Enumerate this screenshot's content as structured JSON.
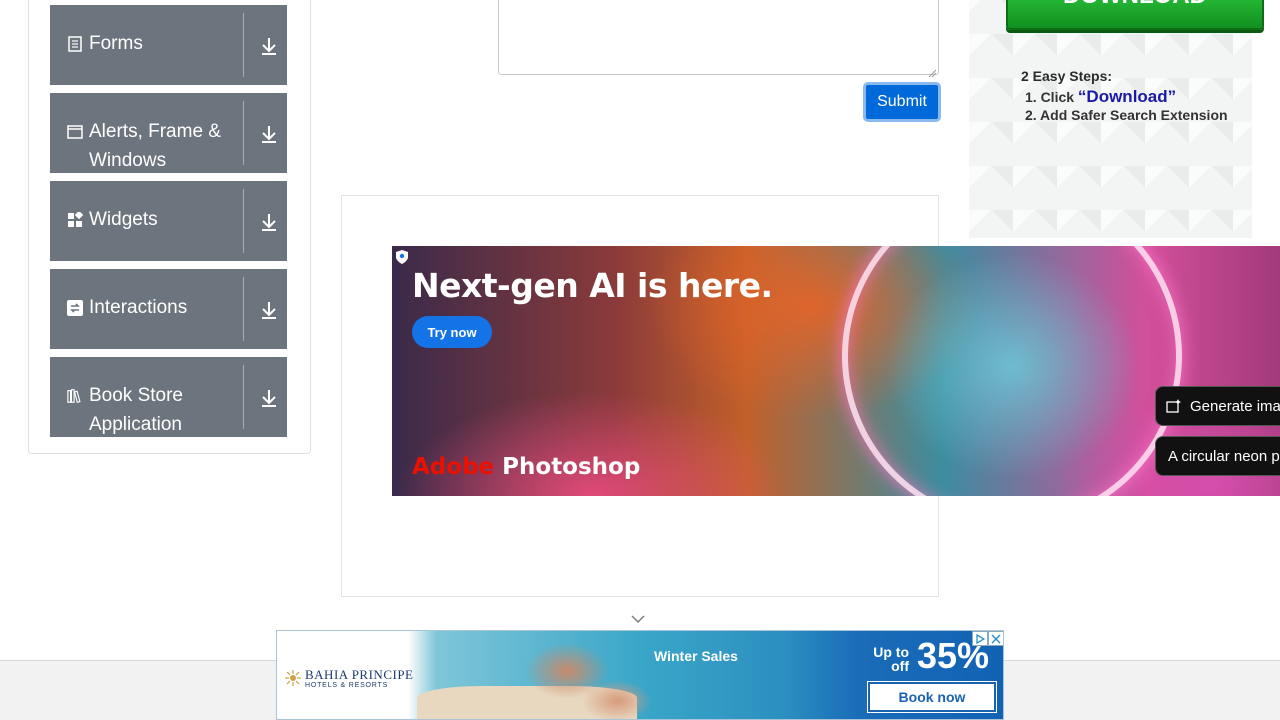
{
  "sidebar": {
    "groups": [
      {
        "label": "Forms",
        "icon": "form-icon"
      },
      {
        "label": "Alerts, Frame & Windows",
        "icon": "window-icon"
      },
      {
        "label": "Widgets",
        "icon": "widgets-icon"
      },
      {
        "label": "Interactions",
        "icon": "interactions-icon"
      },
      {
        "label": "Book Store Application",
        "icon": "book-store-icon"
      }
    ]
  },
  "form": {
    "submit_label": "Submit"
  },
  "right_ad": {
    "download_label": "DOWNLOAD",
    "steps_title": "2 Easy Steps:",
    "step1_prefix": "1. Click ",
    "step1_highlight": "“Download”",
    "step2": "2. Add Safer Search Extension"
  },
  "photoshop_ad": {
    "headline": "Next-gen AI is here.",
    "try_label": "Try now",
    "brand_adobe": "Adobe",
    "brand_product": "Photoshop",
    "pill1": "Generate ima",
    "pill2": "A circular neon p"
  },
  "bottom_ad": {
    "logo": "BAHIA PRINCIPE",
    "logo_sub": "HOTELS & RESORTS",
    "promo": "Winter Sales",
    "up_to": "Up to",
    "off": "off",
    "percent": "35%",
    "book_label": "Book now"
  },
  "colors": {
    "sidebar_group": "#6c757d",
    "submit": "#0069d9",
    "download_green": "#1fae2e",
    "adobe_red": "#eb1000",
    "book_blue": "#1a63b3"
  }
}
